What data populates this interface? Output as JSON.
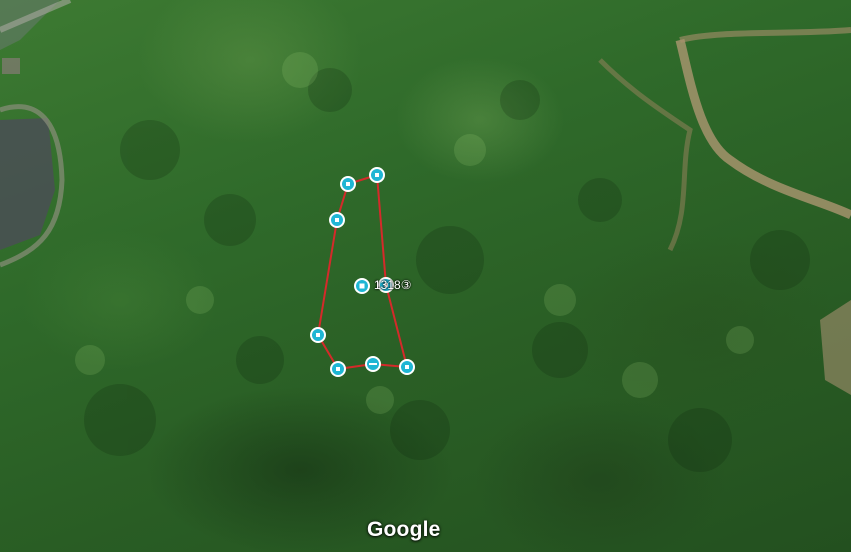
{
  "map": {
    "attribution": "Google",
    "parcel_label": "1318③",
    "boundary_color": "#d42a2a",
    "marker_color": "#1fb6d4",
    "imagery": "satellite-forest"
  },
  "vertices": [
    {
      "id": "v1",
      "icon": "vertex-handle-icon"
    },
    {
      "id": "v2",
      "icon": "vertex-handle-icon"
    },
    {
      "id": "v3",
      "icon": "vertex-handle-icon"
    },
    {
      "id": "v4",
      "icon": "vertex-handle-icon"
    },
    {
      "id": "v5",
      "icon": "vertex-handle-icon"
    },
    {
      "id": "v6",
      "icon": "vertex-handle-icon"
    },
    {
      "id": "v7",
      "icon": "vertex-handle-icon"
    },
    {
      "id": "v8",
      "icon": "vertex-handle-icon"
    }
  ],
  "center_marker": {
    "icon": "parcel-center-icon"
  }
}
